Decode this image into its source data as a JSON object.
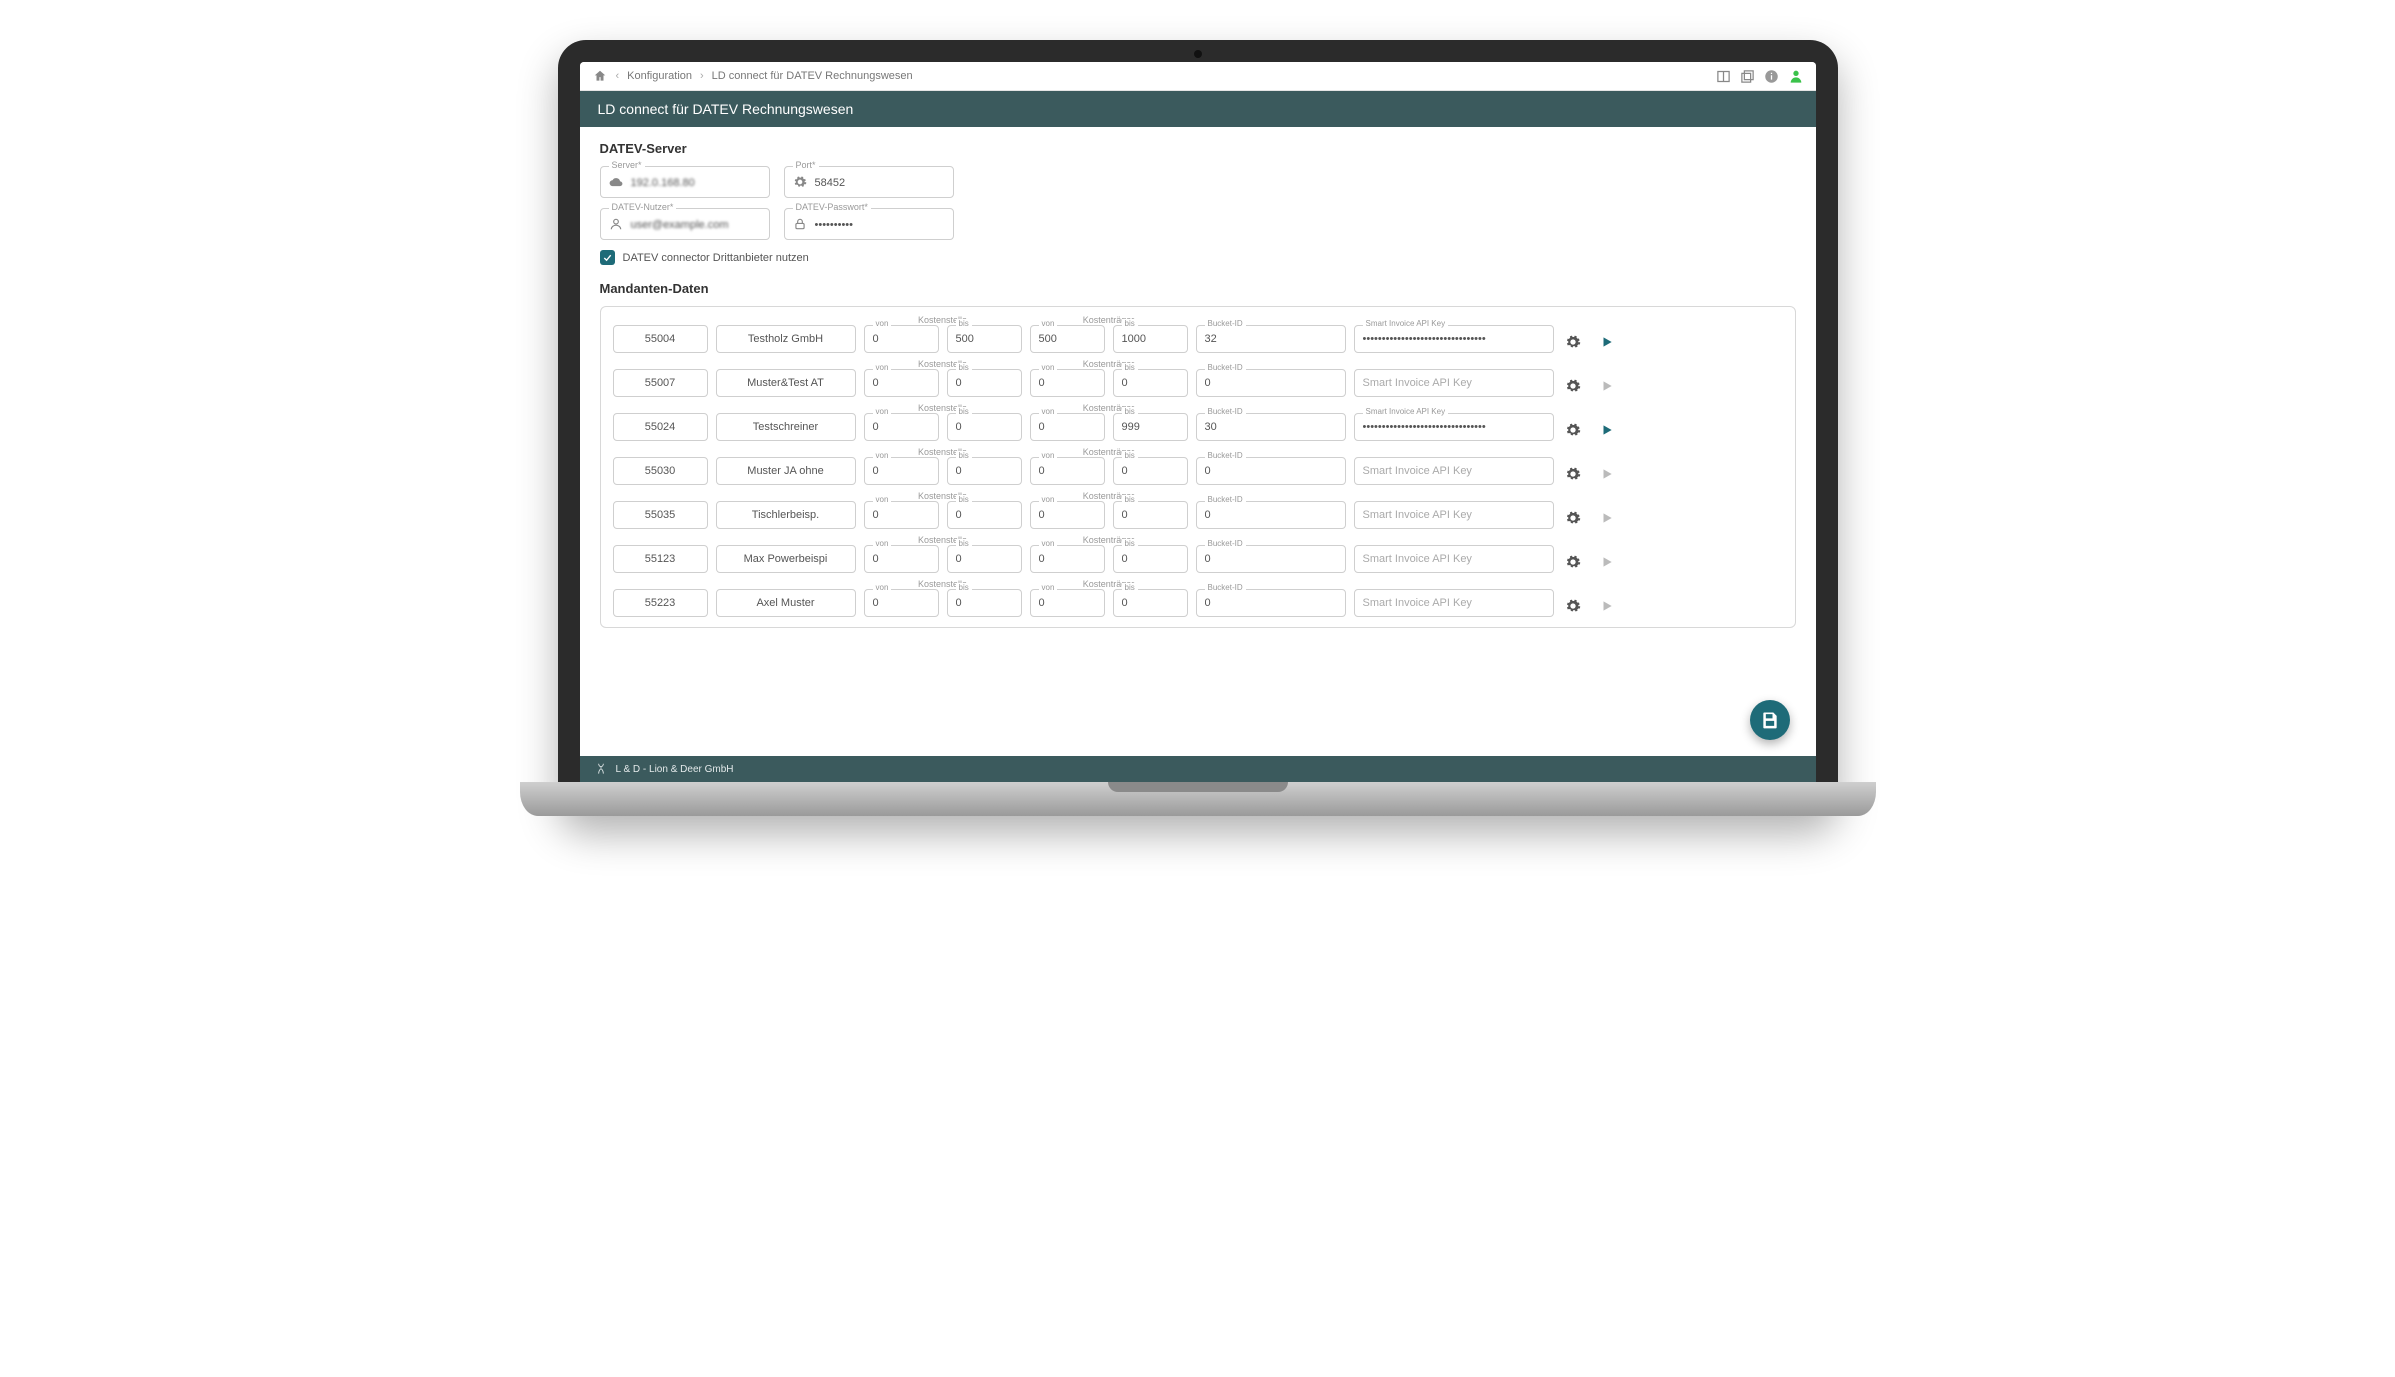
{
  "breadcrumb": {
    "level1": "Konfiguration",
    "level2": "LD connect für DATEV Rechnungswesen"
  },
  "title": "LD connect für DATEV Rechnungswesen",
  "server_section": {
    "heading": "DATEV-Server",
    "server_label": "Server*",
    "server_value": "192.0.168.80",
    "port_label": "Port*",
    "port_value": "58452",
    "user_label": "DATEV-Nutzer*",
    "user_value": "user@example.com",
    "password_label": "DATEV-Passwort*",
    "password_value": "••••••••••",
    "checkbox_label": "DATEV connector Drittanbieter nutzen",
    "checkbox_checked": true
  },
  "mandanten": {
    "heading": "Mandanten-Daten",
    "col_labels": {
      "kostenstelle": "Kostenstelle",
      "kostentraeger": "Kostenträger",
      "von": "von",
      "bis": "bis",
      "bucket": "Bucket-ID",
      "apikey": "Smart Invoice API Key"
    },
    "api_placeholder": "Smart Invoice API Key",
    "rows": [
      {
        "id": "55004",
        "name": "Testholz GmbH",
        "ks_von": "0",
        "ks_bis": "500",
        "kt_von": "500",
        "kt_bis": "1000",
        "bucket": "32",
        "apikey": "••••••••••••••••••••••••••••••••",
        "play_active": true
      },
      {
        "id": "55007",
        "name": "Muster&Test AT",
        "ks_von": "0",
        "ks_bis": "0",
        "kt_von": "0",
        "kt_bis": "0",
        "bucket": "0",
        "apikey": "",
        "play_active": false
      },
      {
        "id": "55024",
        "name": "Testschreiner",
        "ks_von": "0",
        "ks_bis": "0",
        "kt_von": "0",
        "kt_bis": "999",
        "bucket": "30",
        "apikey": "••••••••••••••••••••••••••••••••",
        "play_active": true
      },
      {
        "id": "55030",
        "name": "Muster JA ohne",
        "ks_von": "0",
        "ks_bis": "0",
        "kt_von": "0",
        "kt_bis": "0",
        "bucket": "0",
        "apikey": "",
        "play_active": false
      },
      {
        "id": "55035",
        "name": "Tischlerbeisp.",
        "ks_von": "0",
        "ks_bis": "0",
        "kt_von": "0",
        "kt_bis": "0",
        "bucket": "0",
        "apikey": "",
        "play_active": false
      },
      {
        "id": "55123",
        "name": "Max Powerbeispi",
        "ks_von": "0",
        "ks_bis": "0",
        "kt_von": "0",
        "kt_bis": "0",
        "bucket": "0",
        "apikey": "",
        "play_active": false
      },
      {
        "id": "55223",
        "name": "Axel Muster",
        "ks_von": "0",
        "ks_bis": "0",
        "kt_von": "0",
        "kt_bis": "0",
        "bucket": "0",
        "apikey": "",
        "play_active": false
      }
    ]
  },
  "footer_text": "L & D - Lion & Deer GmbH"
}
